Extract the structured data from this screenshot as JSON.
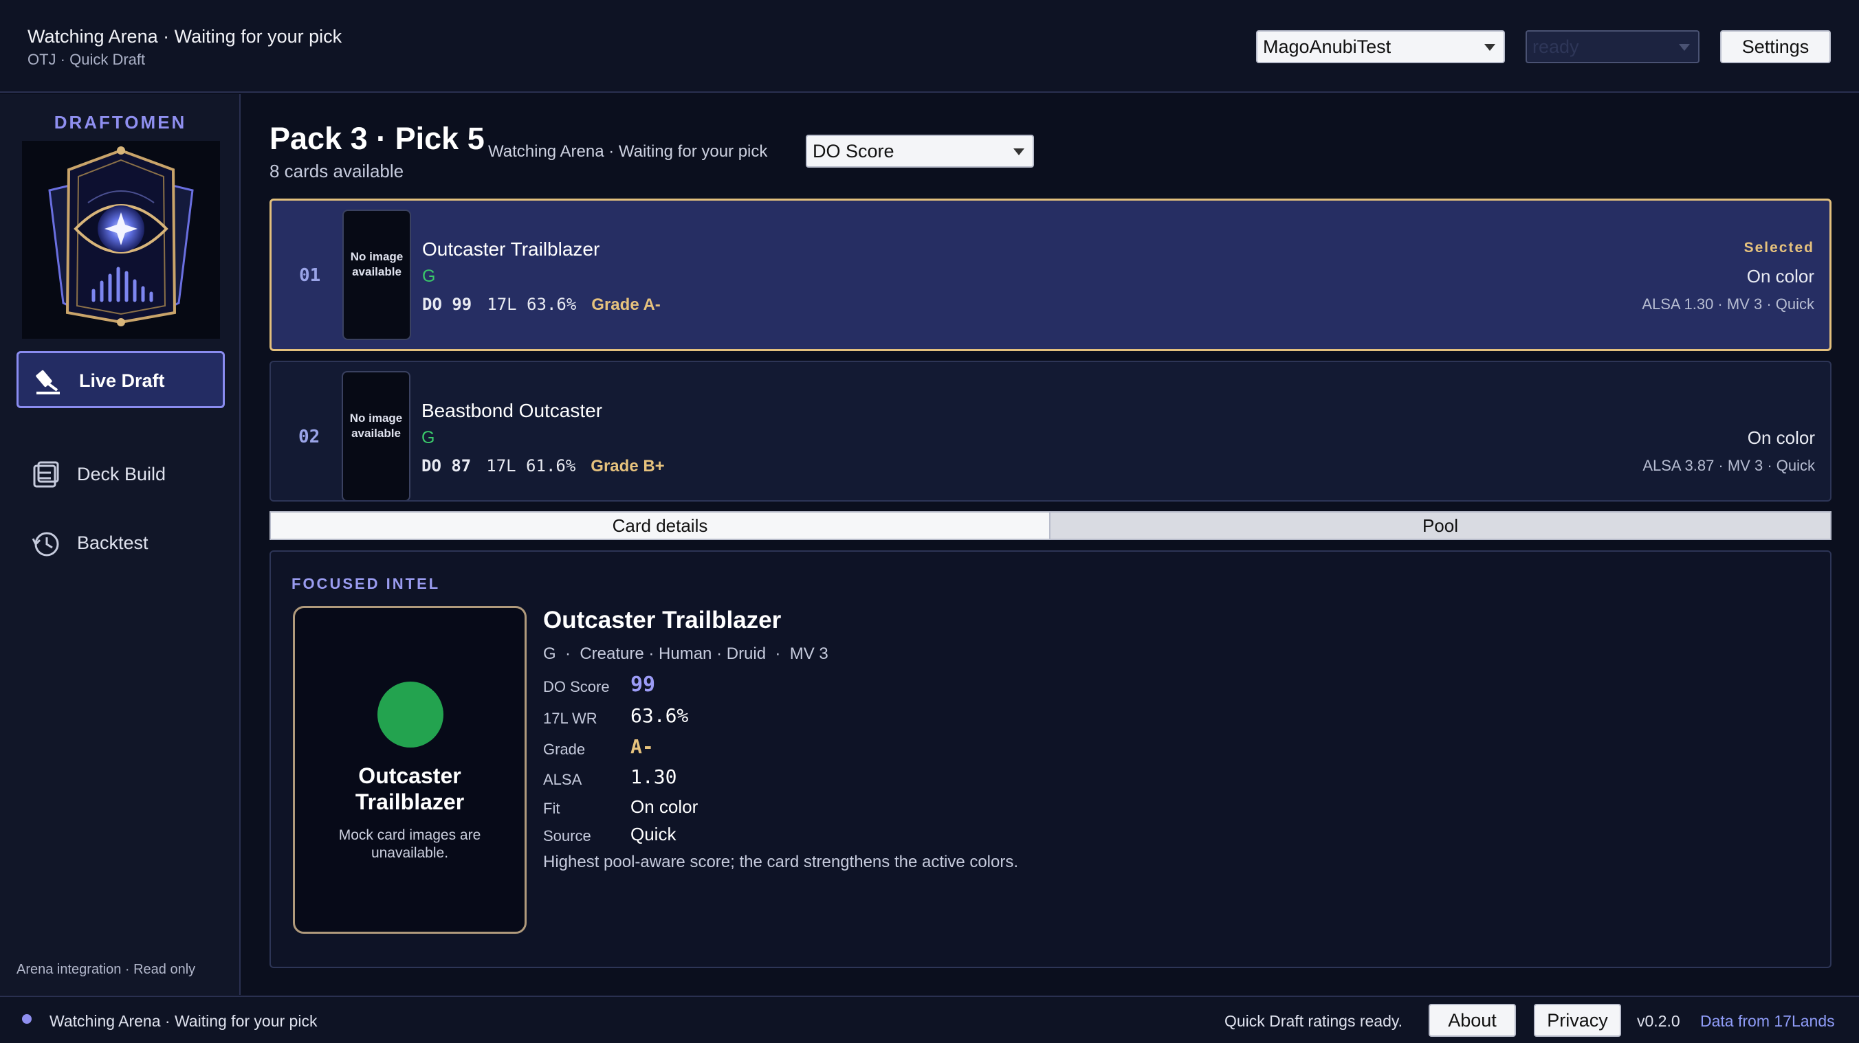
{
  "topbar": {
    "status": "Watching Arena · Waiting for your pick",
    "subtitle": "OTJ · Quick Draft",
    "account": "MagoAnubiTest",
    "status_select": "ready",
    "settings_label": "Settings"
  },
  "sidebar": {
    "brand": "DRAFTOMEN",
    "items": [
      {
        "label": "Live Draft",
        "icon": "gavel-icon",
        "active": true
      },
      {
        "label": "Deck Build",
        "icon": "deck-icon",
        "active": false
      },
      {
        "label": "Backtest",
        "icon": "history-icon",
        "active": false
      }
    ],
    "footer": "Arena integration · Read only"
  },
  "main": {
    "title": "Pack 3 · Pick 5",
    "cards_available": "8 cards available",
    "status": "Watching Arena · Waiting for your pick",
    "sort": "DO Score",
    "cards": [
      {
        "num": "01",
        "thumb": "No image available",
        "name": "Outcaster Trailblazer",
        "color": "G",
        "do": "DO 99",
        "wr": "17L 63.6%",
        "grade": "Grade A-",
        "selected": "Selected",
        "fit": "On color",
        "meta": "ALSA 1.30 · MV 3 · Quick"
      },
      {
        "num": "02",
        "thumb": "No image available",
        "name": "Beastbond Outcaster",
        "color": "G",
        "do": "DO 87",
        "wr": "17L 61.6%",
        "grade": "Grade B+",
        "selected": "",
        "fit": "On color",
        "meta": "ALSA 3.87 · MV 3 · Quick"
      }
    ],
    "tabs": [
      {
        "label": "Card details",
        "active": true
      },
      {
        "label": "Pool",
        "active": false
      }
    ]
  },
  "intel": {
    "heading": "FOCUSED INTEL",
    "card_name": "Outcaster Trailblazer",
    "card_note": "Mock card images are unavailable.",
    "name": "Outcaster Trailblazer",
    "type_line": "G  ·  Creature · Human · Druid  ·  MV 3",
    "fields": [
      {
        "label": "DO Score",
        "value": "99"
      },
      {
        "label": "17L WR",
        "value": "63.6%"
      },
      {
        "label": "Grade",
        "value": "A-"
      },
      {
        "label": "ALSA",
        "value": "1.30"
      },
      {
        "label": "Fit",
        "value": "On color"
      },
      {
        "label": "Source",
        "value": "Quick"
      }
    ],
    "reason": "Highest pool-aware score; the card strengthens the active colors."
  },
  "statusbar": {
    "status": "Watching Arena · Waiting for your pick",
    "ratings": "Quick Draft ratings ready.",
    "about_label": "About",
    "privacy_label": "Privacy",
    "version": "v0.2.0",
    "data_source": "Data from 17Lands"
  },
  "colors": {
    "accent": "#8f8ff0",
    "selected_border": "#e3c07d",
    "green_mana": "#23a34f"
  }
}
